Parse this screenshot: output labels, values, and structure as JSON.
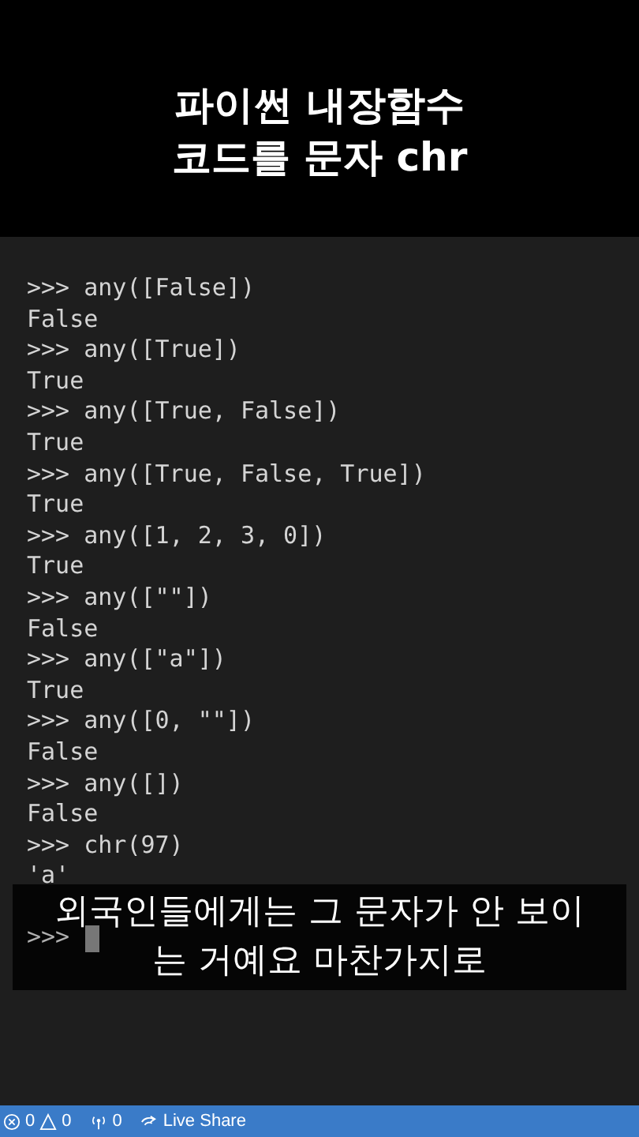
{
  "title_lines": [
    "파이썬 내장함수",
    "코드를 문자 chr"
  ],
  "terminal": {
    "lines": [
      {
        "kind": "input",
        "prompt": ">>>",
        "code": "any([False])"
      },
      {
        "kind": "output",
        "text": "False"
      },
      {
        "kind": "input",
        "prompt": ">>>",
        "code": "any([True])"
      },
      {
        "kind": "output",
        "text": "True"
      },
      {
        "kind": "input",
        "prompt": ">>>",
        "code": "any([True, False])"
      },
      {
        "kind": "output",
        "text": "True"
      },
      {
        "kind": "input",
        "prompt": ">>>",
        "code": "any([True, False, True])"
      },
      {
        "kind": "output",
        "text": "True"
      },
      {
        "kind": "input",
        "prompt": ">>>",
        "code": "any([1, 2, 3, 0])"
      },
      {
        "kind": "output",
        "text": "True"
      },
      {
        "kind": "input",
        "prompt": ">>>",
        "code": "any([\"\"])"
      },
      {
        "kind": "output",
        "text": "False"
      },
      {
        "kind": "input",
        "prompt": ">>>",
        "code": "any([\"a\"])"
      },
      {
        "kind": "output",
        "text": "True"
      },
      {
        "kind": "input",
        "prompt": ">>>",
        "code": "any([0, \"\"])"
      },
      {
        "kind": "output",
        "text": "False"
      },
      {
        "kind": "input",
        "prompt": ">>>",
        "code": "any([])"
      },
      {
        "kind": "output",
        "text": "False"
      },
      {
        "kind": "input",
        "prompt": ">>>",
        "code": "chr(97)"
      },
      {
        "kind": "output",
        "text": "'a'"
      },
      {
        "kind": "cursor",
        "prompt": ">>>"
      }
    ]
  },
  "subtitle": [
    "외국인들에게는 그 문자가 안 보이",
    "는 거예요 마찬가지로"
  ],
  "status_bar": {
    "errors": "0",
    "warnings": "0",
    "ports": "0",
    "live_share": "Live Share"
  }
}
